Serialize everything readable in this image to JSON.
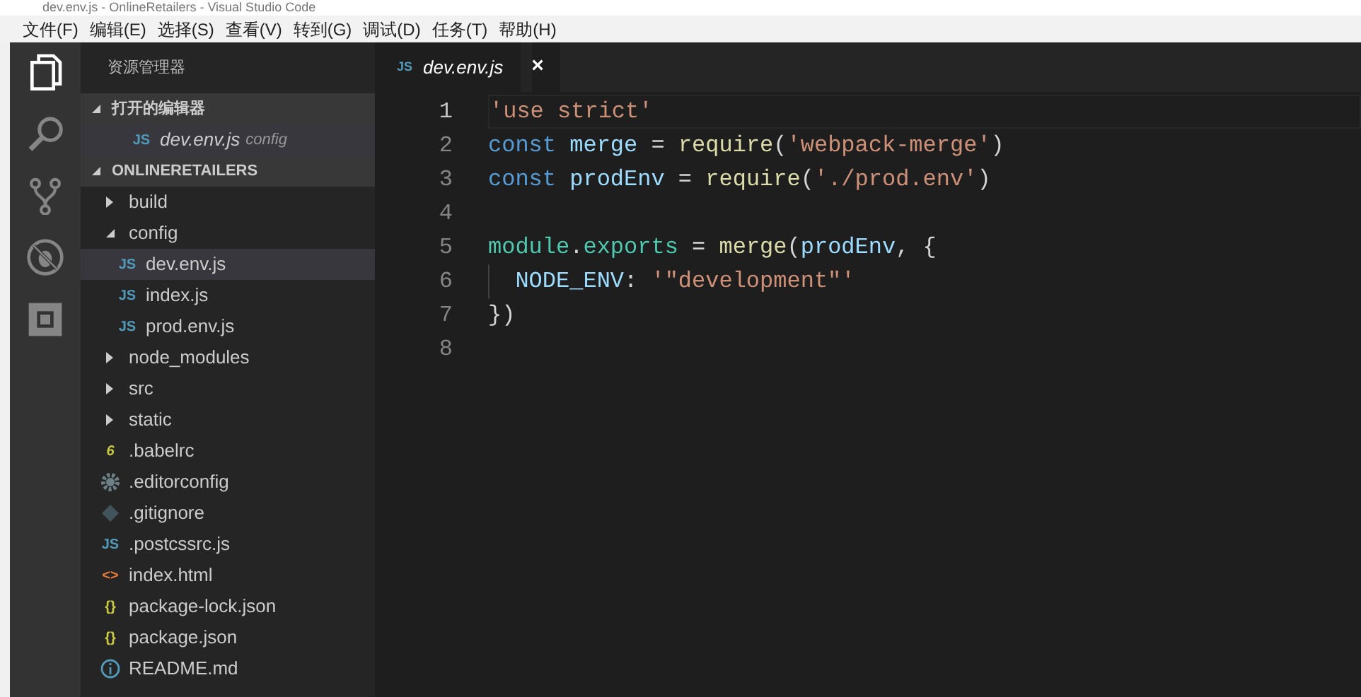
{
  "window": {
    "title": "dev.env.js - OnlineRetailers - Visual Studio Code"
  },
  "menu": [
    "文件(F)",
    "编辑(E)",
    "选择(S)",
    "查看(V)",
    "转到(G)",
    "调试(D)",
    "任务(T)",
    "帮助(H)"
  ],
  "activity_bar": [
    {
      "kind": "files",
      "selected": true
    },
    {
      "kind": "search",
      "selected": false
    },
    {
      "kind": "scm",
      "selected": false
    },
    {
      "kind": "debug",
      "selected": false
    },
    {
      "kind": "extensions",
      "selected": false
    }
  ],
  "sidebar": {
    "title": "资源管理器",
    "open_editors": {
      "label": "打开的编辑器",
      "expanded": true,
      "items": [
        {
          "name": "dev.env.js",
          "description": "config",
          "icon_text": "JS",
          "selected": true
        }
      ]
    },
    "project": {
      "label": "ONLINERETAILERS",
      "expanded": true,
      "children": [
        {
          "label": "build",
          "kind": "folder",
          "expanded": false
        },
        {
          "label": "config",
          "kind": "folder",
          "expanded": true,
          "children": [
            {
              "label": "dev.env.js",
              "kind": "js",
              "icon_text": "JS",
              "selected": true
            },
            {
              "label": "index.js",
              "kind": "js",
              "icon_text": "JS",
              "selected": false
            },
            {
              "label": "prod.env.js",
              "kind": "js",
              "icon_text": "JS",
              "selected": false
            }
          ]
        },
        {
          "label": "node_modules",
          "kind": "folder",
          "expanded": false
        },
        {
          "label": "src",
          "kind": "folder",
          "expanded": false
        },
        {
          "label": "static",
          "kind": "folder",
          "expanded": false
        },
        {
          "label": ".babelrc",
          "kind": "babel",
          "icon_text": "6",
          "selected": false
        },
        {
          "label": ".editorconfig",
          "kind": "settings",
          "selected": false
        },
        {
          "label": ".gitignore",
          "kind": "git",
          "selected": false
        },
        {
          "label": ".postcssrc.js",
          "kind": "js",
          "icon_text": "JS",
          "selected": false
        },
        {
          "label": "index.html",
          "kind": "html",
          "icon_text": "<>",
          "selected": false
        },
        {
          "label": "package-lock.json",
          "kind": "json",
          "icon_text": "{}",
          "selected": false
        },
        {
          "label": "package.json",
          "kind": "json",
          "icon_text": "{}",
          "selected": false
        },
        {
          "label": "README.md",
          "kind": "readme",
          "selected": false
        }
      ]
    }
  },
  "editor": {
    "tabs": [
      {
        "label": "dev.env.js",
        "icon_text": "JS",
        "close": "×",
        "selected": true
      }
    ],
    "lines": [
      {
        "number": "1",
        "current": true,
        "tokens": [
          {
            "kind": "string",
            "text": "'use strict'"
          }
        ]
      },
      {
        "number": "2",
        "current": false,
        "tokens": [
          {
            "kind": "keyword",
            "text": "const "
          },
          {
            "kind": "variable",
            "text": "merge"
          },
          {
            "kind": "plain",
            "text": " = "
          },
          {
            "kind": "function",
            "text": "require"
          },
          {
            "kind": "plain",
            "text": "("
          },
          {
            "kind": "string",
            "text": "'webpack-merge'"
          },
          {
            "kind": "plain",
            "text": ")"
          }
        ]
      },
      {
        "number": "3",
        "current": false,
        "tokens": [
          {
            "kind": "keyword",
            "text": "const "
          },
          {
            "kind": "variable",
            "text": "prodEnv"
          },
          {
            "kind": "plain",
            "text": " = "
          },
          {
            "kind": "function",
            "text": "require"
          },
          {
            "kind": "plain",
            "text": "("
          },
          {
            "kind": "string",
            "text": "'./prod.env'"
          },
          {
            "kind": "plain",
            "text": ")"
          }
        ]
      },
      {
        "number": "4",
        "current": false
      },
      {
        "number": "5",
        "current": false,
        "tokens": [
          {
            "kind": "type",
            "text": "module"
          },
          {
            "kind": "plain",
            "text": "."
          },
          {
            "kind": "type",
            "text": "exports"
          },
          {
            "kind": "plain",
            "text": " = "
          },
          {
            "kind": "function",
            "text": "merge"
          },
          {
            "kind": "plain",
            "text": "("
          },
          {
            "kind": "variable",
            "text": "prodEnv"
          },
          {
            "kind": "plain",
            "text": ", {"
          }
        ]
      },
      {
        "number": "6",
        "current": false,
        "indent_guide": true,
        "tokens": [
          {
            "kind": "variable",
            "text": "NODE_ENV"
          },
          {
            "kind": "plain",
            "text": ": "
          },
          {
            "kind": "string",
            "text": "'\"development\"'"
          }
        ]
      },
      {
        "number": "7",
        "current": false,
        "tokens": [
          {
            "kind": "plain",
            "text": "})"
          }
        ]
      },
      {
        "number": "8",
        "current": false
      }
    ]
  }
}
